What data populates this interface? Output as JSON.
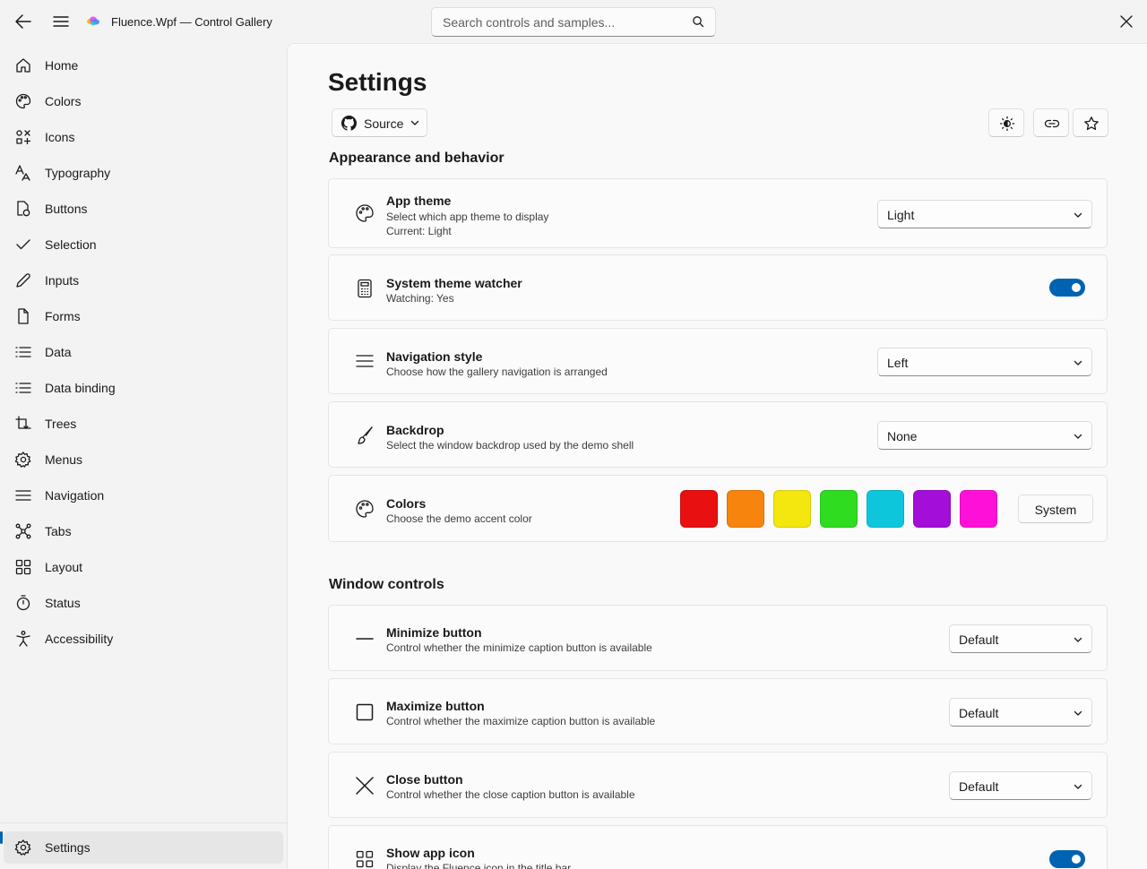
{
  "titlebar": {
    "app_title": "Fluence.Wpf — Control Gallery",
    "search_placeholder": "Search controls and samples...",
    "icons": [
      "back-arrow-icon",
      "hamburger-menu-icon",
      "app-logo-icon",
      "search-icon",
      "close-icon"
    ]
  },
  "sidebar": {
    "items": [
      {
        "label": "Home",
        "icon": "home-icon"
      },
      {
        "label": "Colors",
        "icon": "palette-icon"
      },
      {
        "label": "Icons",
        "icon": "icons-icon"
      },
      {
        "label": "Typography",
        "icon": "typography-icon"
      },
      {
        "label": "Buttons",
        "icon": "buttons-icon"
      },
      {
        "label": "Selection",
        "icon": "checkmark-icon"
      },
      {
        "label": "Inputs",
        "icon": "pencil-icon"
      },
      {
        "label": "Forms",
        "icon": "document-icon"
      },
      {
        "label": "Data",
        "icon": "list-icon"
      },
      {
        "label": "Data binding",
        "icon": "list-icon"
      },
      {
        "label": "Trees",
        "icon": "tree-icon"
      },
      {
        "label": "Menus",
        "icon": "gear-icon"
      },
      {
        "label": "Navigation",
        "icon": "navigation-lines-icon"
      },
      {
        "label": "Tabs",
        "icon": "tabs-icon"
      },
      {
        "label": "Layout",
        "icon": "layout-icon"
      },
      {
        "label": "Status",
        "icon": "timer-icon"
      },
      {
        "label": "Accessibility",
        "icon": "accessibility-icon"
      }
    ],
    "footer_item": {
      "label": "Settings",
      "icon": "gear-icon",
      "selected": true
    }
  },
  "page": {
    "title": "Settings",
    "source_button_label": "Source",
    "toolbar_icons": [
      "theme-toggle-icon",
      "link-icon",
      "star-icon"
    ]
  },
  "appearance": {
    "heading": "Appearance and behavior",
    "app_theme": {
      "title": "App theme",
      "desc": "Select which app theme to display",
      "current": "Current: Light",
      "value": "Light",
      "icon": "palette-icon"
    },
    "theme_watcher": {
      "title": "System theme watcher",
      "desc": "Watching: Yes",
      "on": true,
      "icon": "calculator-icon"
    },
    "navigation_style": {
      "title": "Navigation style",
      "desc": "Choose how the gallery navigation is arranged",
      "value": "Left",
      "icon": "navigation-lines-icon"
    },
    "backdrop": {
      "title": "Backdrop",
      "desc": "Select the window backdrop used by the demo shell",
      "value": "None",
      "icon": "brush-icon"
    },
    "colors": {
      "title": "Colors",
      "desc": "Choose the demo accent color",
      "icon": "palette-icon",
      "swatches": [
        "#e81010",
        "#f7850d",
        "#f3e70f",
        "#2fdc1f",
        "#0ec6dc",
        "#a30fd8",
        "#ff10d8"
      ],
      "system_label": "System"
    }
  },
  "window_controls": {
    "heading": "Window controls",
    "minimize": {
      "title": "Minimize button",
      "desc": "Control whether the minimize caption button is available",
      "value": "Default",
      "icon": "minimize-icon"
    },
    "maximize": {
      "title": "Maximize button",
      "desc": "Control whether the maximize caption button is available",
      "value": "Default",
      "icon": "maximize-icon"
    },
    "close": {
      "title": "Close button",
      "desc": "Control whether the close caption button is available",
      "value": "Default",
      "icon": "close-icon"
    },
    "app_icon": {
      "title": "Show app icon",
      "desc": "Display the Fluence icon in the title bar",
      "on": true,
      "icon": "app-grid-icon"
    }
  },
  "colors": {
    "accent": "#0063b1",
    "window_bg": "#f3f3f3",
    "content_bg": "#f9f9f9",
    "card_bg": "#fbfbfb"
  }
}
